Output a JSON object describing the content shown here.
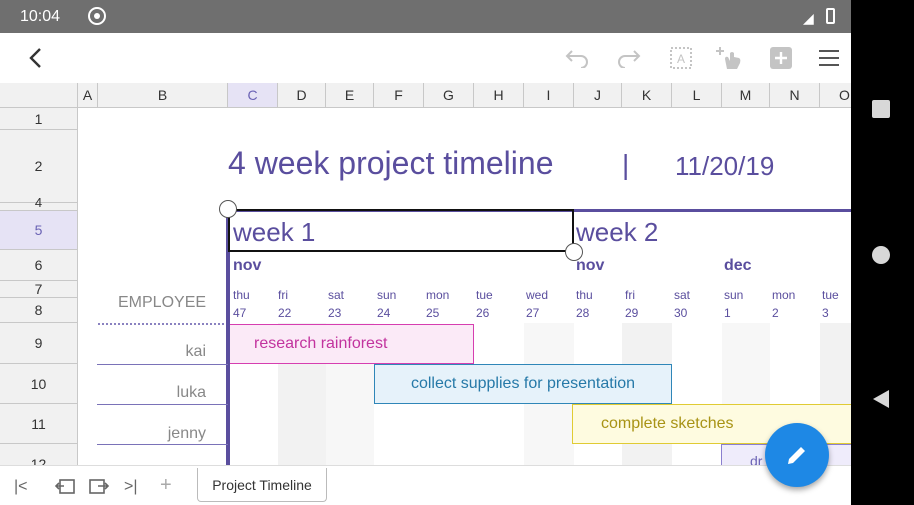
{
  "status": {
    "time": "10:04"
  },
  "sheet": {
    "columns": [
      "A",
      "B",
      "C",
      "D",
      "E",
      "F",
      "G",
      "H",
      "I",
      "J",
      "K",
      "L",
      "M",
      "N",
      "O"
    ],
    "selected_column": "C",
    "rows": [
      "1",
      "2",
      "4",
      "5",
      "6",
      "7",
      "8",
      "9",
      "10",
      "11",
      "12"
    ],
    "selected_row": "5",
    "title": "4 week project timeline",
    "title_sep": "|",
    "date": "11/20/19",
    "weeks": [
      "week 1",
      "week 2"
    ],
    "months": [
      "nov",
      "nov",
      "dec"
    ],
    "days": [
      {
        "dow": "thu",
        "num": "47"
      },
      {
        "dow": "fri",
        "num": "22"
      },
      {
        "dow": "sat",
        "num": "23"
      },
      {
        "dow": "sun",
        "num": "24"
      },
      {
        "dow": "mon",
        "num": "25"
      },
      {
        "dow": "tue",
        "num": "26"
      },
      {
        "dow": "wed",
        "num": "27"
      },
      {
        "dow": "thu",
        "num": "28"
      },
      {
        "dow": "fri",
        "num": "29"
      },
      {
        "dow": "sat",
        "num": "30"
      },
      {
        "dow": "sun",
        "num": "1"
      },
      {
        "dow": "mon",
        "num": "2"
      },
      {
        "dow": "tue",
        "num": "3"
      }
    ],
    "employee_header": "EMPLOYEE",
    "employees": [
      "kai",
      "luka",
      "jenny"
    ],
    "tasks": [
      {
        "label": "research rainforest",
        "fill": "#fbeaf7",
        "border": "#d63eb0",
        "color": "#c2339e"
      },
      {
        "label": "collect supplies for presentation",
        "fill": "#e6f2fa",
        "border": "#2f86b8",
        "color": "#2679a8"
      },
      {
        "label": "complete sketches",
        "fill": "#fefbe0",
        "border": "#e0cb33",
        "color": "#a89315"
      },
      {
        "label": "dr      ent",
        "fill": "#efecfb",
        "border": "#8a7fcf",
        "color": "#6b63b5"
      }
    ]
  },
  "tabbar": {
    "sheet_tab": "Project Timeline"
  },
  "colors": {
    "accent": "#5a4e9e",
    "fab": "#1e88e5"
  }
}
